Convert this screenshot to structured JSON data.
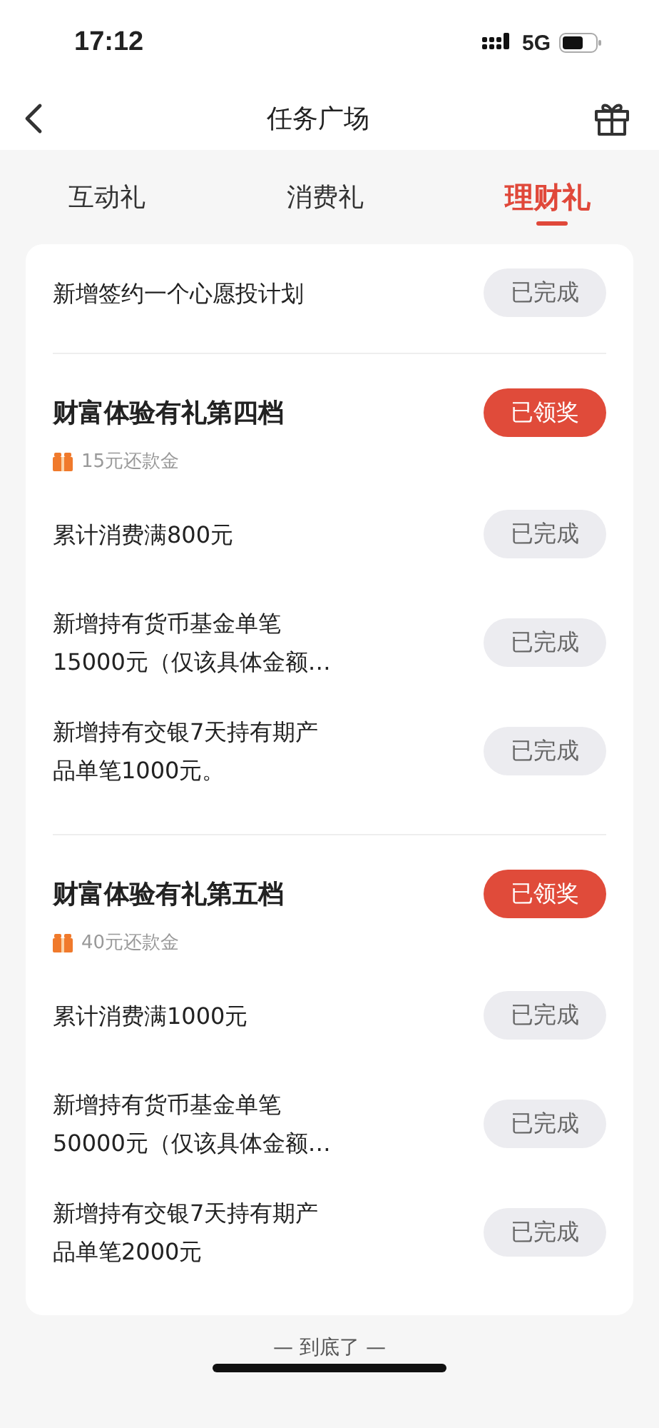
{
  "status_bar": {
    "time": "17:12",
    "network": "5G"
  },
  "nav": {
    "title": "任务广场"
  },
  "tabs": [
    {
      "label": "互动礼",
      "selected": false
    },
    {
      "label": "消费礼",
      "selected": false
    },
    {
      "label": "理财礼",
      "selected": true
    }
  ],
  "sections": [
    {
      "tasks": [
        {
          "text": "新增签约一个心愿投计划",
          "button": {
            "label": "已完成",
            "kind": "done"
          }
        }
      ]
    },
    {
      "title": "财富体验有礼第四档",
      "button": {
        "label": "已领奖",
        "kind": "claimed"
      },
      "reward": "15元还款金",
      "tasks": [
        {
          "text": "累计消费满800元",
          "button": {
            "label": "已完成",
            "kind": "done"
          }
        },
        {
          "text": "新增持有货币基金单笔\n15000元（仅该具体金额…",
          "button": {
            "label": "已完成",
            "kind": "done"
          }
        },
        {
          "text": "新增持有交银7天持有期产品单笔1000元。",
          "button": {
            "label": "已完成",
            "kind": "done"
          }
        }
      ]
    },
    {
      "title": "财富体验有礼第五档",
      "button": {
        "label": "已领奖",
        "kind": "claimed"
      },
      "reward": "40元还款金",
      "tasks": [
        {
          "text": "累计消费满1000元",
          "button": {
            "label": "已完成",
            "kind": "done"
          }
        },
        {
          "text": "新增持有货币基金单笔\n50000元（仅该具体金额…",
          "button": {
            "label": "已完成",
            "kind": "done"
          }
        },
        {
          "text": "新增持有交银7天持有期产品单笔2000元",
          "button": {
            "label": "已完成",
            "kind": "done"
          }
        }
      ]
    }
  ],
  "footer": "— 到底了 —"
}
